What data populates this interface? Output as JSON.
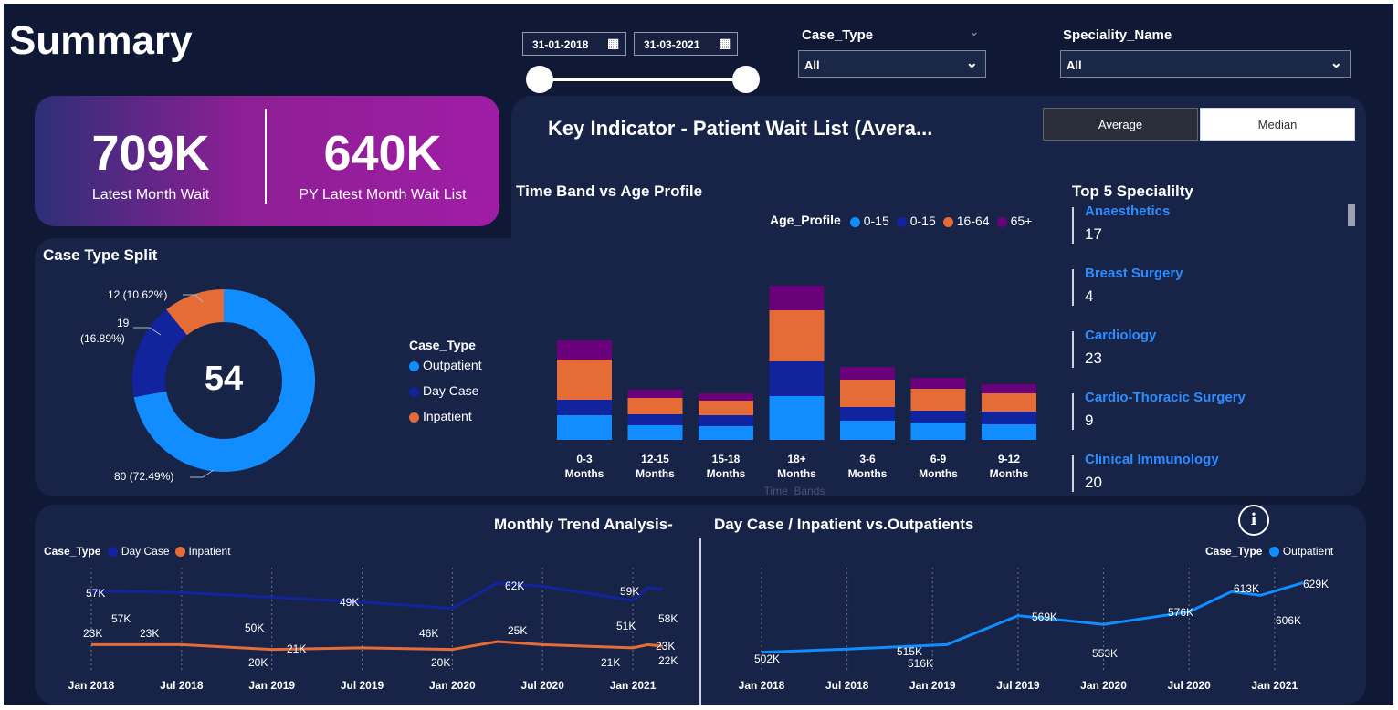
{
  "header": {
    "title": "Summary",
    "date_start": "31-01-2018",
    "date_end": "31-03-2021",
    "case_type_filter": {
      "label": "Case_Type",
      "value": "All"
    },
    "speciality_filter": {
      "label": "Speciality_Name",
      "value": "All"
    }
  },
  "kpis": {
    "latest": {
      "value": "709K",
      "label": "Latest Month Wait"
    },
    "py_latest": {
      "value": "640K",
      "label": "PY Latest Month Wait List"
    }
  },
  "key_indicator": {
    "title": "Key Indicator - Patient Wait List (Avera...",
    "toggle": {
      "average": "Average",
      "median": "Median",
      "selected": "Average"
    }
  },
  "case_type_split": {
    "title": "Case Type Split",
    "center_value": "54",
    "legend_title": "Case_Type",
    "legend": [
      {
        "label": "Outpatient",
        "color": "#118DFF"
      },
      {
        "label": "Day Case",
        "color": "#12239E"
      },
      {
        "label": "Inpatient",
        "color": "#E66C37"
      }
    ],
    "labels": {
      "inpatient": "12 (10.62%)",
      "daycase_line1": "19",
      "daycase_line2": "(16.89%)",
      "outpatient": "80 (72.49%)"
    }
  },
  "time_band": {
    "title": "Time Band vs Age Profile",
    "legend_title": "Age_Profile",
    "legend": [
      {
        "label": "0-15",
        "color": "#118DFF"
      },
      {
        "label": "0-15",
        "color": "#12239E"
      },
      {
        "label": "16-64",
        "color": "#E66C37"
      },
      {
        "label": "65+",
        "color": "#6B007B"
      }
    ],
    "axis_label": "Time_Bands"
  },
  "top_speciality": {
    "title": "Top 5 Specialilty",
    "items": [
      {
        "name": "Anaesthetics",
        "value": "17"
      },
      {
        "name": "Breast Surgery",
        "value": "4"
      },
      {
        "name": "Cardiology",
        "value": "23"
      },
      {
        "name": "Cardio-Thoracic Surgery",
        "value": "9"
      },
      {
        "name": "Clinical Immunology",
        "value": "20"
      }
    ]
  },
  "trend": {
    "title_left": "Monthly Trend Analysis-",
    "title_right": "Day Case / Inpatient vs.Outpatients",
    "info_icon": "info-icon",
    "left_legend_title": "Case_Type",
    "left_legend": [
      {
        "label": "Day Case",
        "color": "#12239E"
      },
      {
        "label": "Inpatient",
        "color": "#E66C37"
      }
    ],
    "right_legend_title": "Case_Type",
    "right_legend": [
      {
        "label": "Outpatient",
        "color": "#118DFF"
      }
    ]
  },
  "chart_data": [
    {
      "type": "pie",
      "title": "Case Type Split",
      "categories": [
        "Outpatient",
        "Day Case",
        "Inpatient"
      ],
      "values": [
        80,
        19,
        12
      ],
      "percentages": [
        72.49,
        16.89,
        10.62
      ],
      "colors": [
        "#118DFF",
        "#12239E",
        "#E66C37"
      ],
      "center_label": "54"
    },
    {
      "type": "bar",
      "title": "Time Band vs Age Profile",
      "stacked": true,
      "categories": [
        "0-3 Months",
        "12-15 Months",
        "15-18 Months",
        "18+ Months",
        "3-6 Months",
        "6-9 Months",
        "9-12 Months"
      ],
      "xlabel": "Time_Bands",
      "series": [
        {
          "name": "0-15",
          "color": "#118DFF",
          "values": [
            27,
            16,
            15,
            48,
            21,
            19,
            17
          ]
        },
        {
          "name": "0-15",
          "color": "#12239E",
          "values": [
            17,
            12,
            12,
            38,
            15,
            13,
            14
          ]
        },
        {
          "name": "16-64",
          "color": "#E66C37",
          "values": [
            44,
            18,
            16,
            56,
            30,
            24,
            20
          ]
        },
        {
          "name": "65+",
          "color": "#6B007B",
          "values": [
            21,
            9,
            8,
            27,
            14,
            12,
            10
          ]
        }
      ],
      "legend": "top"
    },
    {
      "type": "line",
      "title": "Monthly Trend Analysis-",
      "x": [
        "Jan 2018",
        "Jul 2018",
        "Jan 2019",
        "Jul 2019",
        "Jan 2020",
        "Jul 2020",
        "Jan 2021"
      ],
      "series": [
        {
          "name": "Day Case",
          "color": "#12239E",
          "points": [
            [
              "Jan 2018",
              57000
            ],
            [
              "Jul 2018",
              56000
            ],
            [
              "Jan 2019",
              53000
            ],
            [
              "Jul 2019",
              50000
            ],
            [
              "Jan 2020",
              46000
            ],
            [
              "Apr 2020",
              62000
            ],
            [
              "Jul 2020",
              60000
            ],
            [
              "Jan 2021",
              51000
            ],
            [
              "Feb 2021",
              59000
            ],
            [
              "Mar 2021",
              58000
            ]
          ]
        },
        {
          "name": "Inpatient",
          "color": "#E66C37",
          "points": [
            [
              "Jan 2018",
              23000
            ],
            [
              "Jul 2018",
              23000
            ],
            [
              "Jan 2019",
              20000
            ],
            [
              "Jul 2019",
              21000
            ],
            [
              "Jan 2020",
              20000
            ],
            [
              "Apr 2020",
              25000
            ],
            [
              "Jul 2020",
              23000
            ],
            [
              "Jan 2021",
              21000
            ],
            [
              "Feb 2021",
              23000
            ],
            [
              "Mar 2021",
              22000
            ]
          ]
        }
      ],
      "data_labels": [
        "57K",
        "57K",
        "23K",
        "23K",
        "50K",
        "49K",
        "20K",
        "21K",
        "46K",
        "20K",
        "62K",
        "25K",
        "59K",
        "51K",
        "58K",
        "21K",
        "23K",
        "22K"
      ],
      "legend": "top-left"
    },
    {
      "type": "line",
      "title": "Day Case / Inpatient vs.Outpatients",
      "x": [
        "Jan 2018",
        "Jul 2018",
        "Jan 2019",
        "Jul 2019",
        "Jan 2020",
        "Jul 2020",
        "Jan 2021"
      ],
      "series": [
        {
          "name": "Outpatient",
          "color": "#118DFF",
          "points": [
            [
              "Jan 2018",
              502000
            ],
            [
              "Jul 2018",
              508000
            ],
            [
              "Jan 2019",
              515000
            ],
            [
              "Feb 2019",
              516000
            ],
            [
              "Jul 2019",
              569000
            ],
            [
              "Jan 2020",
              553000
            ],
            [
              "Jul 2020",
              576000
            ],
            [
              "Oct 2020",
              613000
            ],
            [
              "Dec 2020",
              606000
            ],
            [
              "Mar 2021",
              629000
            ]
          ]
        }
      ],
      "data_labels": [
        "502K",
        "515K",
        "516K",
        "569K",
        "553K",
        "576K",
        "613K",
        "606K",
        "629K"
      ],
      "legend": "top-right"
    }
  ]
}
